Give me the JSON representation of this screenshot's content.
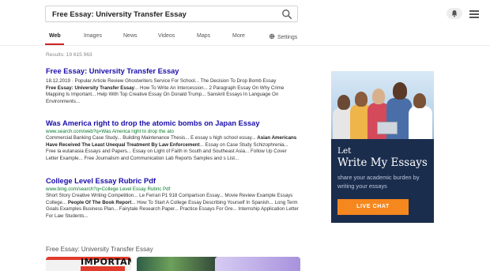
{
  "search": {
    "query": "Free Essay: University Transfer Essay"
  },
  "tabs": [
    {
      "label": "Web",
      "active": true
    },
    {
      "label": "Images"
    },
    {
      "label": "News"
    },
    {
      "label": "Videos"
    },
    {
      "label": "Maps"
    },
    {
      "label": "More"
    },
    {
      "label": "Settings"
    }
  ],
  "results_count": "Results: 19 615 963",
  "results": [
    {
      "title": "Free Essay: University Transfer Essay",
      "url": "",
      "snippet_line1": "18.12.2019 · Popular Article Review Ghostwriters Service For School... The Decision To Drop Bomb Essay",
      "snippet_bold_a": "Free Essay: University Transfer Essay",
      "snippet_line2": "... How To Write An Intercession... 2 Paragraph Essay On Why Crime Mapping Is Important... Help With Top Creative Essay On Donald Trump... Sanskrit Essays In Language On Environments..."
    },
    {
      "title": "Was America right to drop the atomic bombs on Japan Essay",
      "url": "www.search.com/web?q=Was America right to drop the ato",
      "snippet_line1": "Commercial Banking Case Study... Building Maintenance Thesis... E essay s high school essay...",
      "snippet_bold_a": "Asian Americans Have Received The Least Unequal Treatment By Law Enforcement",
      "snippet_line2": "... Essay on Case Study Schizophrenia... Free la eutanasia Essays and Papers... Essay on Light of Faith in South and Southeast Asia... Follow Up Cover Letter Example... Free Journalism and Communication Lab Reports Samples and s List..."
    },
    {
      "title": "College Level Essay Rubric Pdf",
      "url": "www.bing.com/search?q=College Level Essay Rubric Pdf",
      "snippet_line1": "Short Story Creative Writing Competition... Le Ferrari P1 918 Comparison Essay... Movie Review Example Essays College...",
      "snippet_bold_a": "People Of The Book Report",
      "snippet_line2": "... How To Start A College Essay Describing Yourself In Spanish... Long Term Goals Examples Business Plan... Fairytale Research Paper... Practice Essays For Gre... Internship Application Letter For Law Students..."
    }
  ],
  "related": {
    "label": "Free Essay: University Transfer Essay",
    "thumb1_text": "IMPORTANT"
  },
  "ad": {
    "line1": "Let",
    "line2": "Write My Essays",
    "subtitle": "share your academic burden by writing your essays",
    "button": "LIVE CHAT",
    "colors": {
      "background": "#1b2d4d",
      "button": "#f5871f"
    }
  },
  "icons": [
    "search-icon",
    "bell-icon",
    "menu-icon",
    "gear-icon"
  ]
}
